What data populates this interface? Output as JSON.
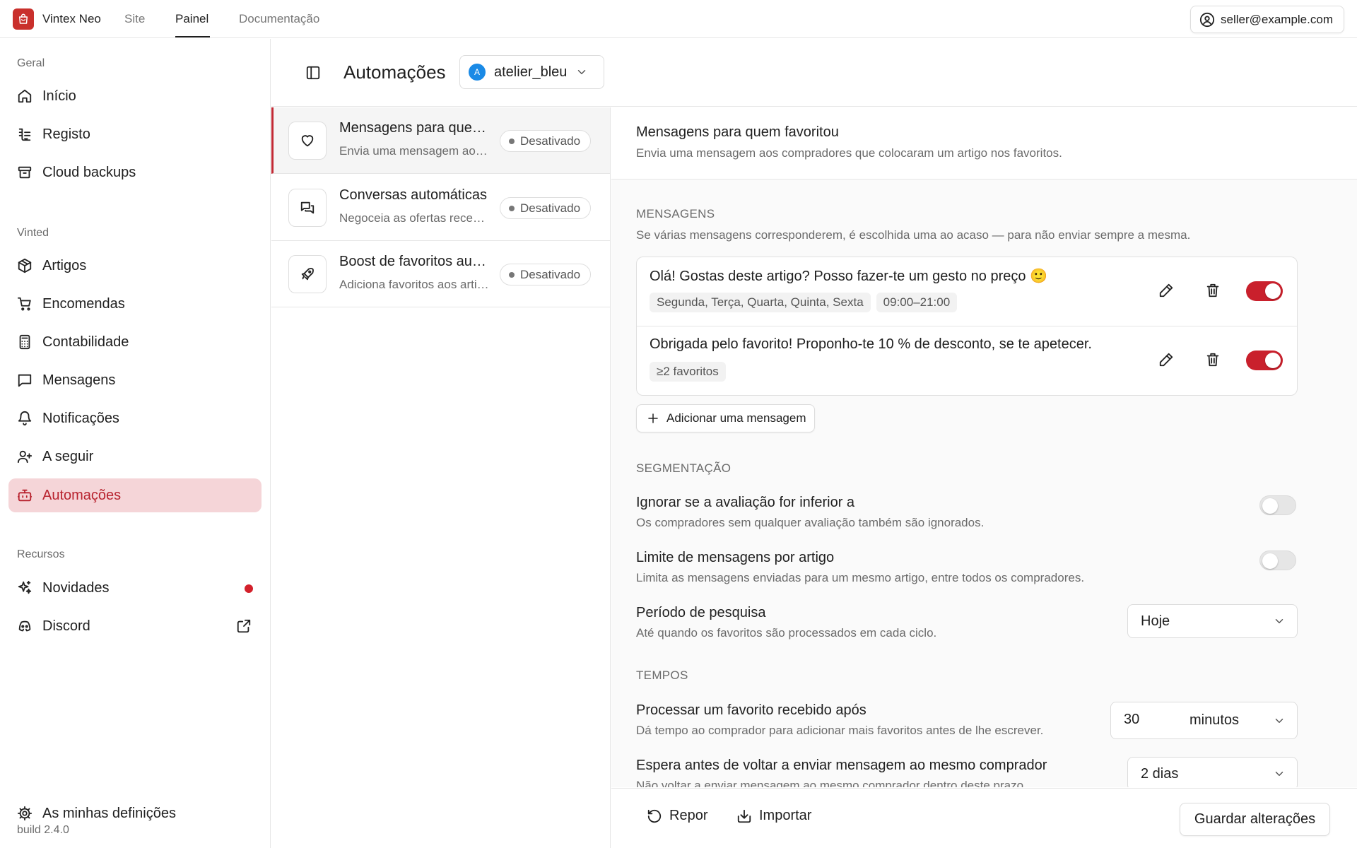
{
  "topbar": {
    "brand": "Vintex Neo",
    "nav": [
      {
        "label": "Site",
        "active": false
      },
      {
        "label": "Painel",
        "active": true
      },
      {
        "label": "Documentação",
        "active": false
      }
    ],
    "user_email": "seller@example.com"
  },
  "sidebar": {
    "sections": [
      {
        "label": "Geral",
        "items": [
          {
            "label": "Início",
            "icon": "home-icon"
          },
          {
            "label": "Registo",
            "icon": "log-icon"
          },
          {
            "label": "Cloud backups",
            "icon": "archive-icon"
          }
        ]
      },
      {
        "label": "Vinted",
        "items": [
          {
            "label": "Artigos",
            "icon": "package-icon"
          },
          {
            "label": "Encomendas",
            "icon": "cart-icon"
          },
          {
            "label": "Contabilidade",
            "icon": "calculator-icon"
          },
          {
            "label": "Mensagens",
            "icon": "message-icon"
          },
          {
            "label": "Notificações",
            "icon": "bell-icon"
          },
          {
            "label": "A seguir",
            "icon": "user-plus-icon"
          },
          {
            "label": "Automações",
            "icon": "bot-icon",
            "active": true
          }
        ]
      },
      {
        "label": "Recursos",
        "items": [
          {
            "label": "Novidades",
            "icon": "sparkles-icon",
            "dot": true
          },
          {
            "label": "Discord",
            "icon": "discord-icon",
            "external": true
          }
        ]
      }
    ],
    "settings_label": "As minhas definições",
    "build": "build 2.4.0"
  },
  "header": {
    "title": "Automações",
    "account": {
      "initial": "A",
      "name": "atelier_bleu",
      "avatar_color": "#1a8ae6"
    }
  },
  "automations": [
    {
      "title": "Mensagens para quem favoritou",
      "desc": "Envia uma mensagem aos compradores que colocaram um artigo nos favoritos.",
      "status": "Desativado",
      "icon": "heart-icon",
      "selected": true
    },
    {
      "title": "Conversas automáticas",
      "desc": "Negoceia as ofertas recebidas automaticamente.",
      "status": "Desativado",
      "icon": "chat-icon",
      "selected": false
    },
    {
      "title": "Boost de favoritos automático",
      "desc": "Adiciona favoritos aos artigos automaticamente.",
      "status": "Desativado",
      "icon": "rocket-icon",
      "selected": false
    }
  ],
  "detail": {
    "title": "Mensagens para quem favoritou",
    "subtitle": "Envia uma mensagem aos compradores que colocaram um artigo nos favoritos.",
    "messages_section": {
      "label": "MENSAGENS",
      "hint": "Se várias mensagens corresponderem, é escolhida uma ao acaso — para não enviar sempre a mesma.",
      "items": [
        {
          "text": "Olá! Gostas deste artigo? Posso fazer-te um gesto no preço 🙂",
          "chips": [
            "Segunda, Terça, Quarta, Quinta, Sexta",
            "09:00–21:00"
          ],
          "enabled": true
        },
        {
          "text": "Obrigada pelo favorito! Proponho-te 10 % de desconto, se te apetecer.",
          "chips": [
            "≥2 favoritos"
          ],
          "enabled": true
        }
      ],
      "add_label": "Adicionar uma mensagem"
    },
    "targeting": {
      "label": "SEGMENTAÇÃO",
      "rating": {
        "title": "Ignorar se a avaliação for inferior a",
        "desc": "Os compradores sem qualquer avaliação também são ignorados.",
        "enabled": false
      },
      "limit": {
        "title": "Limite de mensagens por artigo",
        "desc": "Limita as mensagens enviadas para um mesmo artigo, entre todos os compradores.",
        "enabled": false
      },
      "period": {
        "title": "Período de pesquisa",
        "desc": "Até quando os favoritos são processados em cada ciclo.",
        "value": "Hoje"
      }
    },
    "timing": {
      "label": "TEMPOS",
      "delay": {
        "title": "Processar um favorito recebido após",
        "desc": "Dá tempo ao comprador para adicionar mais favoritos antes de lhe escrever.",
        "value": "30",
        "unit": "minutos"
      },
      "cooldown": {
        "title": "Espera antes de voltar a enviar mensagem ao mesmo comprador",
        "desc": "Não voltar a enviar mensagem ao mesmo comprador dentro deste prazo.",
        "value": "2 dias"
      }
    }
  },
  "footer": {
    "reset_label": "Repor",
    "import_label": "Importar",
    "save_label": "Guardar alterações"
  },
  "colors": {
    "accent": "#c9202c",
    "active_bg": "#f5d5d8",
    "avatar": "#1a8ae6"
  }
}
